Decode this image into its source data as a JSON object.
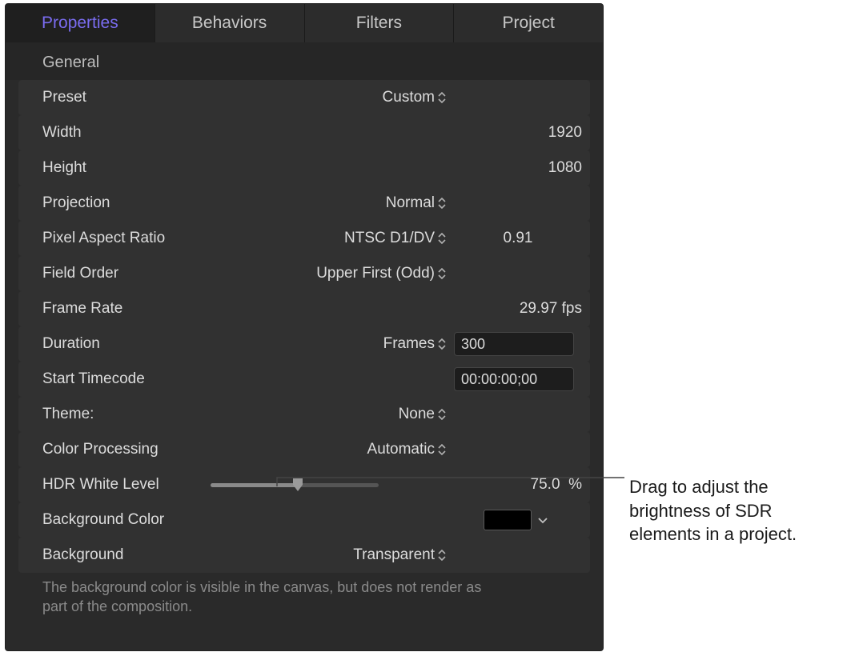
{
  "tabs": {
    "properties": "Properties",
    "behaviors": "Behaviors",
    "filters": "Filters",
    "project": "Project"
  },
  "section": {
    "general": "General"
  },
  "rows": {
    "preset": {
      "label": "Preset",
      "value": "Custom"
    },
    "width": {
      "label": "Width",
      "value": "1920"
    },
    "height": {
      "label": "Height",
      "value": "1080"
    },
    "projection": {
      "label": "Projection",
      "value": "Normal"
    },
    "par": {
      "label": "Pixel Aspect Ratio",
      "value": "NTSC D1/DV",
      "number": "0.91"
    },
    "field_order": {
      "label": "Field Order",
      "value": "Upper First (Odd)"
    },
    "frame_rate": {
      "label": "Frame Rate",
      "value": "29.97",
      "unit": "fps"
    },
    "duration": {
      "label": "Duration",
      "unit_popup": "Frames",
      "value": "300"
    },
    "start_tc": {
      "label": "Start Timecode",
      "value": "00:00:00;00"
    },
    "theme": {
      "label": "Theme:",
      "value": "None"
    },
    "color_proc": {
      "label": "Color Processing",
      "value": "Automatic"
    },
    "hdr_white": {
      "label": "HDR White Level",
      "value": "75.0",
      "unit": "%"
    },
    "bg_color": {
      "label": "Background Color",
      "hex": "#000000"
    },
    "background": {
      "label": "Background",
      "value": "Transparent"
    }
  },
  "helper": "The background color is visible in the canvas, but does not render as part of the composition.",
  "callout": "Drag to adjust the brightness of SDR elements in a project."
}
